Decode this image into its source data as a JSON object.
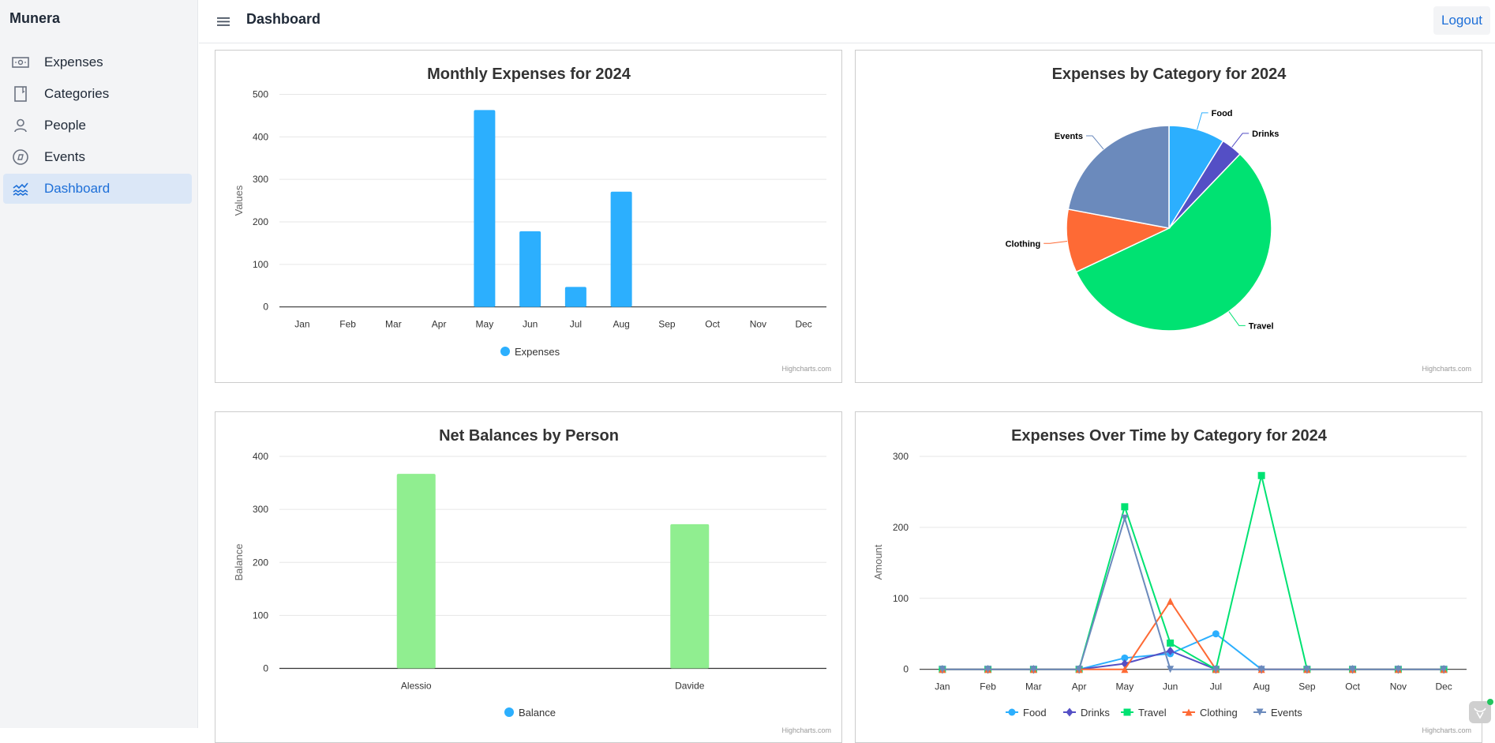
{
  "app": {
    "brand": "Munera",
    "page_title": "Dashboard",
    "logout_label": "Logout"
  },
  "sidebar": {
    "items": [
      {
        "label": "Expenses",
        "icon": "banknote-icon",
        "active": false
      },
      {
        "label": "Categories",
        "icon": "book-icon",
        "active": false
      },
      {
        "label": "People",
        "icon": "user-icon",
        "active": false
      },
      {
        "label": "Events",
        "icon": "compass-icon",
        "active": false
      },
      {
        "label": "Dashboard",
        "icon": "chart-waves-icon",
        "active": true
      }
    ]
  },
  "colors": {
    "accent": "#1d6fd8",
    "active_bg": "#dbe7f7",
    "series_blue": "#2caffe",
    "balance_green": "#90ee90"
  },
  "credits": "Highcharts.com",
  "chart_data": [
    {
      "id": "monthly",
      "type": "bar",
      "title": "Monthly Expenses for 2024",
      "xlabel": "",
      "ylabel": "Values",
      "ylim": [
        0,
        500
      ],
      "yticks": [
        0,
        100,
        200,
        300,
        400,
        500
      ],
      "categories": [
        "Jan",
        "Feb",
        "Mar",
        "Apr",
        "May",
        "Jun",
        "Jul",
        "Aug",
        "Sep",
        "Oct",
        "Nov",
        "Dec"
      ],
      "series": [
        {
          "name": "Expenses",
          "color": "#2caffe",
          "values": [
            0,
            0,
            0,
            0,
            463,
            178,
            47,
            271,
            0,
            0,
            0,
            0
          ]
        }
      ],
      "legend": "bottom-center",
      "grid": true
    },
    {
      "id": "category_pie",
      "type": "pie",
      "title": "Expenses by Category for 2024",
      "slices": [
        {
          "name": "Food",
          "value": 85,
          "color": "#2caffe"
        },
        {
          "name": "Drinks",
          "value": 32,
          "color": "#544fc5"
        },
        {
          "name": "Travel",
          "value": 537,
          "color": "#00e272"
        },
        {
          "name": "Clothing",
          "value": 96,
          "color": "#fe6a35"
        },
        {
          "name": "Events",
          "value": 212,
          "color": "#6b8abc"
        }
      ]
    },
    {
      "id": "balances",
      "type": "bar",
      "title": "Net Balances by Person",
      "xlabel": "",
      "ylabel": "Balance",
      "ylim": [
        0,
        400
      ],
      "yticks": [
        0,
        100,
        200,
        300,
        400
      ],
      "categories": [
        "Alessio",
        "Davide"
      ],
      "series": [
        {
          "name": "Balance",
          "color": "#90ee90",
          "legend_color": "#2caffe",
          "values": [
            367,
            272
          ]
        }
      ],
      "legend": "bottom-center",
      "grid": true
    },
    {
      "id": "over_time",
      "type": "line",
      "title": "Expenses Over Time by Category for 2024",
      "xlabel": "",
      "ylabel": "Amount",
      "ylim": [
        0,
        300
      ],
      "yticks": [
        0,
        100,
        200,
        300
      ],
      "categories": [
        "Jan",
        "Feb",
        "Mar",
        "Apr",
        "May",
        "Jun",
        "Jul",
        "Aug",
        "Sep",
        "Oct",
        "Nov",
        "Dec"
      ],
      "series": [
        {
          "name": "Food",
          "color": "#2caffe",
          "marker": "circle",
          "values": [
            0,
            0,
            0,
            0,
            16,
            22,
            50,
            0,
            0,
            0,
            0,
            0
          ]
        },
        {
          "name": "Drinks",
          "color": "#544fc5",
          "marker": "diamond",
          "values": [
            0,
            0,
            0,
            0,
            8,
            26,
            0,
            0,
            0,
            0,
            0,
            0
          ]
        },
        {
          "name": "Travel",
          "color": "#00e272",
          "marker": "square",
          "values": [
            0,
            0,
            0,
            0,
            229,
            37,
            0,
            273,
            0,
            0,
            0,
            0
          ]
        },
        {
          "name": "Clothing",
          "color": "#fe6a35",
          "marker": "triangle",
          "values": [
            0,
            0,
            0,
            0,
            0,
            96,
            0,
            0,
            0,
            0,
            0,
            0
          ]
        },
        {
          "name": "Events",
          "color": "#6b8abc",
          "marker": "triangle-down",
          "values": [
            0,
            0,
            0,
            0,
            213,
            0,
            0,
            0,
            0,
            0,
            0,
            0
          ]
        }
      ],
      "legend": "bottom-center",
      "grid": true
    }
  ]
}
